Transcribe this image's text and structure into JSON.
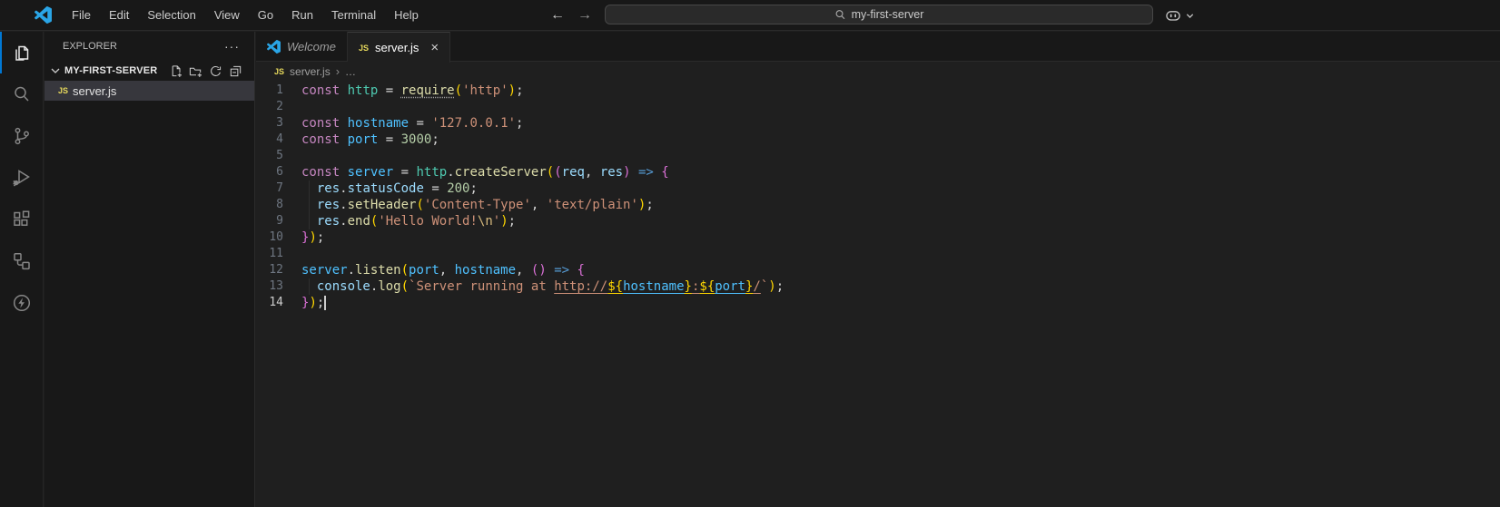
{
  "titlebar": {
    "menu": [
      "File",
      "Edit",
      "Selection",
      "View",
      "Go",
      "Run",
      "Terminal",
      "Help"
    ],
    "back_icon": "←",
    "forward_icon": "→",
    "search_value": "my-first-server"
  },
  "activity_bar": {
    "items": [
      {
        "id": "explorer",
        "icon": "files-icon",
        "active": true
      },
      {
        "id": "search",
        "icon": "search-icon",
        "active": false
      },
      {
        "id": "source-control",
        "icon": "source-control-icon",
        "active": false
      },
      {
        "id": "run-and-debug",
        "icon": "run-debug-icon",
        "active": false
      },
      {
        "id": "extensions",
        "icon": "extensions-icon",
        "active": false
      },
      {
        "id": "remote-explorer",
        "icon": "remote-icon",
        "active": false
      },
      {
        "id": "thunder-client",
        "icon": "thunder-icon",
        "active": false
      }
    ]
  },
  "explorer": {
    "title": "EXPLORER",
    "more_label": "···",
    "workspace": "MY-FIRST-SERVER",
    "actions": [
      {
        "id": "new-file",
        "icon": "new-file-icon"
      },
      {
        "id": "new-folder",
        "icon": "new-folder-icon"
      },
      {
        "id": "refresh",
        "icon": "refresh-icon"
      },
      {
        "id": "collapse-all",
        "icon": "collapse-all-icon"
      }
    ],
    "files": [
      {
        "name": "server.js",
        "icon_label": "JS",
        "selected": true
      }
    ]
  },
  "tabs": [
    {
      "label": "Welcome",
      "icon": "vscode",
      "italic": true,
      "active": false
    },
    {
      "label": "server.js",
      "icon": "js",
      "italic": false,
      "active": true,
      "close": "×"
    }
  ],
  "breadcrumb": {
    "icon_label": "JS",
    "file": "server.js",
    "separator": "›",
    "symbol": "…"
  },
  "editor": {
    "cursor_line": 14,
    "lines": [
      {
        "n": 1,
        "tokens": [
          {
            "c": "kw",
            "t": "const"
          },
          {
            "c": "punct",
            "t": " "
          },
          {
            "c": "mod",
            "t": "http"
          },
          {
            "c": "op",
            "t": " = "
          },
          {
            "c": "fn",
            "t": "require",
            "hint": true
          },
          {
            "c": "p1",
            "t": "("
          },
          {
            "c": "str",
            "t": "'http'"
          },
          {
            "c": "p1",
            "t": ")"
          },
          {
            "c": "punct",
            "t": ";"
          }
        ]
      },
      {
        "n": 2,
        "tokens": []
      },
      {
        "n": 3,
        "tokens": [
          {
            "c": "kw",
            "t": "const"
          },
          {
            "c": "punct",
            "t": " "
          },
          {
            "c": "cvar",
            "t": "hostname"
          },
          {
            "c": "op",
            "t": " = "
          },
          {
            "c": "str",
            "t": "'127.0.0.1'"
          },
          {
            "c": "punct",
            "t": ";"
          }
        ]
      },
      {
        "n": 4,
        "tokens": [
          {
            "c": "kw",
            "t": "const"
          },
          {
            "c": "punct",
            "t": " "
          },
          {
            "c": "cvar",
            "t": "port"
          },
          {
            "c": "op",
            "t": " = "
          },
          {
            "c": "num",
            "t": "3000"
          },
          {
            "c": "punct",
            "t": ";"
          }
        ]
      },
      {
        "n": 5,
        "tokens": []
      },
      {
        "n": 6,
        "tokens": [
          {
            "c": "kw",
            "t": "const"
          },
          {
            "c": "punct",
            "t": " "
          },
          {
            "c": "cvar",
            "t": "server"
          },
          {
            "c": "op",
            "t": " = "
          },
          {
            "c": "mod",
            "t": "http"
          },
          {
            "c": "punct",
            "t": "."
          },
          {
            "c": "fn",
            "t": "createServer"
          },
          {
            "c": "p1",
            "t": "("
          },
          {
            "c": "p2",
            "t": "("
          },
          {
            "c": "pvar",
            "t": "req"
          },
          {
            "c": "punct",
            "t": ", "
          },
          {
            "c": "pvar",
            "t": "res"
          },
          {
            "c": "p2",
            "t": ")"
          },
          {
            "c": "arrow",
            "t": " => "
          },
          {
            "c": "p2",
            "t": "{"
          }
        ]
      },
      {
        "n": 7,
        "guide": true,
        "tokens": [
          {
            "c": "punct",
            "t": "  "
          },
          {
            "c": "pvar",
            "t": "res"
          },
          {
            "c": "punct",
            "t": "."
          },
          {
            "c": "pvar",
            "t": "statusCode"
          },
          {
            "c": "op",
            "t": " = "
          },
          {
            "c": "num",
            "t": "200"
          },
          {
            "c": "punct",
            "t": ";"
          }
        ]
      },
      {
        "n": 8,
        "guide": true,
        "tokens": [
          {
            "c": "punct",
            "t": "  "
          },
          {
            "c": "pvar",
            "t": "res"
          },
          {
            "c": "punct",
            "t": "."
          },
          {
            "c": "fn",
            "t": "setHeader"
          },
          {
            "c": "p1",
            "t": "("
          },
          {
            "c": "str",
            "t": "'Content-Type'"
          },
          {
            "c": "punct",
            "t": ", "
          },
          {
            "c": "str",
            "t": "'text/plain'"
          },
          {
            "c": "p1",
            "t": ")"
          },
          {
            "c": "punct",
            "t": ";"
          }
        ]
      },
      {
        "n": 9,
        "guide": true,
        "tokens": [
          {
            "c": "punct",
            "t": "  "
          },
          {
            "c": "pvar",
            "t": "res"
          },
          {
            "c": "punct",
            "t": "."
          },
          {
            "c": "fn",
            "t": "end"
          },
          {
            "c": "p1",
            "t": "("
          },
          {
            "c": "str",
            "t": "'Hello World!"
          },
          {
            "c": "esc",
            "t": "\\n"
          },
          {
            "c": "str",
            "t": "'"
          },
          {
            "c": "p1",
            "t": ")"
          },
          {
            "c": "punct",
            "t": ";"
          }
        ]
      },
      {
        "n": 10,
        "tokens": [
          {
            "c": "p2",
            "t": "}"
          },
          {
            "c": "p1",
            "t": ")"
          },
          {
            "c": "punct",
            "t": ";"
          }
        ]
      },
      {
        "n": 11,
        "tokens": []
      },
      {
        "n": 12,
        "tokens": [
          {
            "c": "cvar",
            "t": "server"
          },
          {
            "c": "punct",
            "t": "."
          },
          {
            "c": "fn",
            "t": "listen"
          },
          {
            "c": "p1",
            "t": "("
          },
          {
            "c": "cvar",
            "t": "port"
          },
          {
            "c": "punct",
            "t": ", "
          },
          {
            "c": "cvar",
            "t": "hostname"
          },
          {
            "c": "punct",
            "t": ", "
          },
          {
            "c": "p2",
            "t": "("
          },
          {
            "c": "p2",
            "t": ")"
          },
          {
            "c": "arrow",
            "t": " => "
          },
          {
            "c": "p2",
            "t": "{"
          }
        ]
      },
      {
        "n": 13,
        "guide": true,
        "tokens": [
          {
            "c": "punct",
            "t": "  "
          },
          {
            "c": "pvar",
            "t": "console"
          },
          {
            "c": "punct",
            "t": "."
          },
          {
            "c": "fn",
            "t": "log"
          },
          {
            "c": "p1",
            "t": "("
          },
          {
            "c": "str",
            "t": "`Server running at "
          },
          {
            "c": "str",
            "t": "http://",
            "u": true
          },
          {
            "c": "tpl",
            "t": "${",
            "u": true
          },
          {
            "c": "cvar",
            "t": "hostname",
            "u": true
          },
          {
            "c": "tpl",
            "t": "}",
            "u": true
          },
          {
            "c": "str",
            "t": ":",
            "u": true
          },
          {
            "c": "tpl",
            "t": "${",
            "u": true
          },
          {
            "c": "cvar",
            "t": "port",
            "u": true
          },
          {
            "c": "tpl",
            "t": "}",
            "u": true
          },
          {
            "c": "str",
            "t": "/",
            "u": true
          },
          {
            "c": "str",
            "t": "`"
          },
          {
            "c": "p1",
            "t": ")"
          },
          {
            "c": "punct",
            "t": ";"
          }
        ]
      },
      {
        "n": 14,
        "current": true,
        "cursor": true,
        "tokens": [
          {
            "c": "p2",
            "t": "}"
          },
          {
            "c": "p1",
            "t": ")"
          },
          {
            "c": "punct",
            "t": ";"
          }
        ]
      }
    ]
  },
  "colors": {
    "accent": "#0078d4",
    "logo_blue": "#2aa5e6",
    "js_badge": "#e7d95c",
    "editor_bg": "#1f1f1f",
    "panel_bg": "#181818",
    "border": "#2b2b2b"
  }
}
